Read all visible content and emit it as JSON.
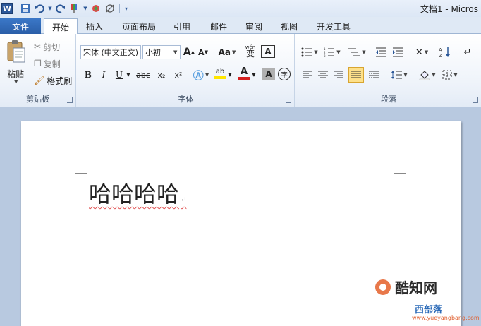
{
  "window": {
    "title": "文档1 - Micros"
  },
  "qat": {
    "icons": [
      "word-app-icon",
      "save-icon",
      "undo-icon",
      "redo-icon",
      "format-painter-icon",
      "color-icon",
      "no-color-icon",
      "customize-qat-icon"
    ]
  },
  "tabs": [
    "文件",
    "开始",
    "插入",
    "页面布局",
    "引用",
    "邮件",
    "审阅",
    "视图",
    "开发工具"
  ],
  "active_tab": "开始",
  "clipboard": {
    "paste": "粘贴",
    "cut": "剪切",
    "copy": "复制",
    "format_painter": "格式刷",
    "label": "剪贴板"
  },
  "font": {
    "name": "宋体 (中文正文)",
    "size": "小初",
    "label": "字体",
    "grow": "A",
    "shrink": "A",
    "case": "Aa",
    "bold": "B",
    "italic": "I",
    "underline": "U",
    "strike": "abc",
    "subscript": "x₂",
    "superscript": "x²",
    "highlight_letters": "ab",
    "font_color": "A",
    "char_shade": "A",
    "char_border": "A",
    "enclose": "字",
    "phonetic": "wén"
  },
  "paragraph": {
    "label": "段落"
  },
  "document": {
    "text": "哈哈哈哈"
  },
  "watermark": {
    "logo_text": "酷知网",
    "site_text": "西部落",
    "url": "www.yueyangbang.com"
  },
  "colors": {
    "file_tab": "#2a5ea8",
    "font_color_bar": "#d42020",
    "highlight_bar": "#ffe600"
  }
}
